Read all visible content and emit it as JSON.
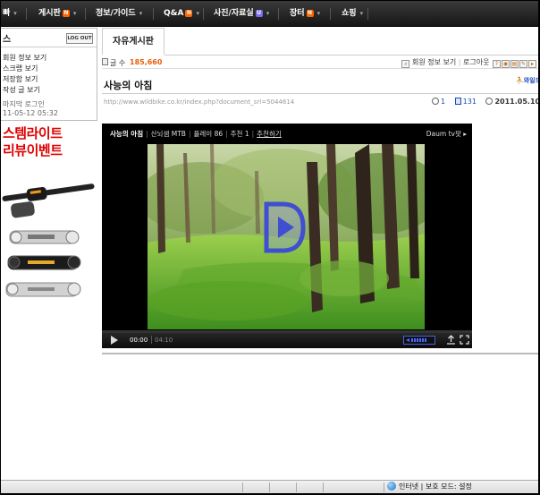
{
  "nav": {
    "first_label": "빠",
    "items": [
      {
        "label": "게시판",
        "badge": "N"
      },
      {
        "label": "정보/가이드",
        "badge": ""
      },
      {
        "label": "Q&A",
        "badge": "N"
      },
      {
        "label": "사진/자료실",
        "badge": "U"
      },
      {
        "label": "장터",
        "badge": "N"
      },
      {
        "label": "쇼핑",
        "badge": ""
      }
    ]
  },
  "login": {
    "title": "스",
    "logout_label": "LOG OUT",
    "links": [
      "회원 정보 보기",
      "스크랩 보기",
      "저장함 보기",
      "작성 글 보기"
    ],
    "last_login_label": "마지막 로그인",
    "last_login_time": "11-05-12 05:32"
  },
  "promo": {
    "line1": "스템라이트",
    "line2": "리뷰이벤트",
    "product_text": "STEMLIGHT"
  },
  "board": {
    "tab_label": "자유게시판",
    "count_label": "글 수",
    "count_value": "185,660",
    "member_info_label": "회원 정보 보기",
    "logout_label": "로그아웃"
  },
  "post": {
    "title": "사능의 아침",
    "url": "http://www.wildbike.co.kr/index.php?document_srl=5044614",
    "comments": "1",
    "views": "131",
    "date": "2011.05.10 13:3",
    "side_logo_text": "와일드"
  },
  "player": {
    "title": "사능의 아침",
    "channel": "산뇌샘 MTB",
    "plays": "플레이 86",
    "recommends": "추천 1",
    "recommend_link": "추천하기",
    "brand": "Daum tv팟 ▸",
    "time_current": "00:00",
    "time_total": "04:10",
    "volume_level": 0.65
  },
  "statusbar": {
    "zone_text": "인터넷 | 보호 모드: 설정"
  },
  "colors": {
    "accent_orange": "#e8600a",
    "link_blue": "#1a49b8",
    "promo_red": "#e00000"
  }
}
